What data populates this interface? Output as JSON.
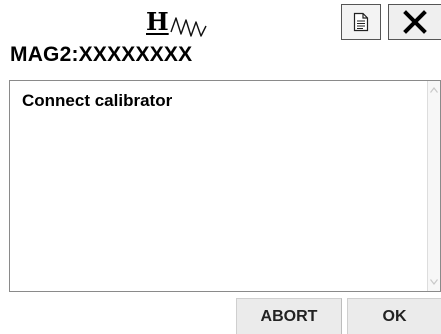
{
  "header": {
    "logo_letter": "H",
    "device_title": "MAG2:XXXXXXXX"
  },
  "toolbar": {
    "icons": [
      "document-icon",
      "close-icon"
    ]
  },
  "message": {
    "text": "Connect calibrator"
  },
  "footer": {
    "abort_label": "ABORT",
    "ok_label": "OK"
  }
}
